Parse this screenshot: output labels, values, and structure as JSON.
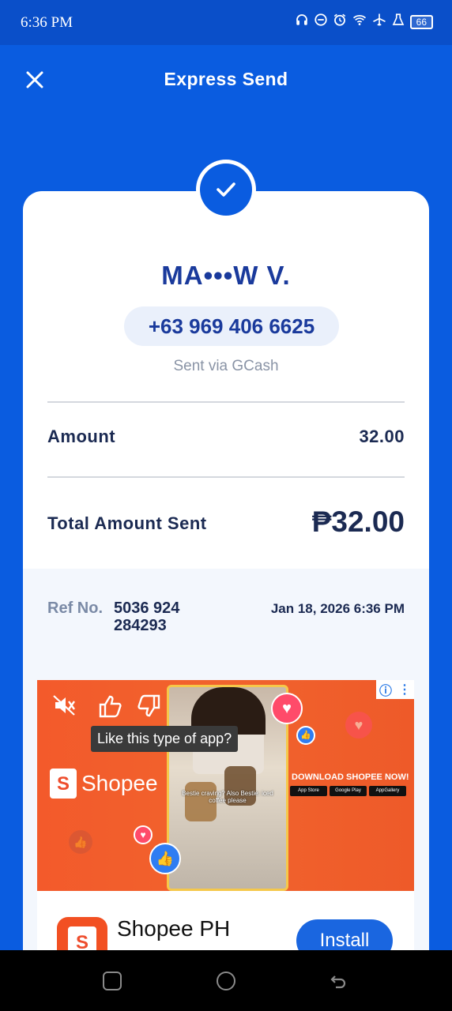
{
  "status_bar": {
    "time": "6:36 PM",
    "battery": "66",
    "icons": [
      "headset-icon",
      "do-not-disturb-icon",
      "alarm-icon",
      "wifi-icon",
      "airplane-icon",
      "flask-icon",
      "battery-icon"
    ]
  },
  "header": {
    "title": "Express Send",
    "close_icon": "close-icon"
  },
  "receipt": {
    "recipient_name": "MA•••W V.",
    "recipient_number": "+63 969 406 6625",
    "sent_via": "Sent via GCash",
    "amount_label": "Amount",
    "amount_value": "32.00",
    "total_label": "Total Amount Sent",
    "total_value": "₱32.00",
    "ref_label": "Ref No.",
    "ref_value": "5036 924 284293",
    "date": "Jan 18, 2026 6:36 PM"
  },
  "ad": {
    "tooltip": "Like this type of app?",
    "brand": "Shopee",
    "brand_letter": "S",
    "download_text": "DOWNLOAD SHOPEE NOW!",
    "store_badges": [
      "App Store",
      "Google Play",
      "AppGallery"
    ],
    "video_caption": "Bestie craving? Also Bestie: iced coffee please",
    "app_name": "Shopee PH",
    "install_label": "Install",
    "info_icon": "info-icon",
    "more_icon": "more-vertical-icon"
  },
  "colors": {
    "primary": "#0a5ce0",
    "text_dark": "#1b2a52",
    "text_name": "#1a3a9c",
    "muted": "#8a94a6",
    "ref_bg": "#f3f7fd",
    "ad_orange": "#f35a2b",
    "install_blue": "#1a66e0"
  }
}
